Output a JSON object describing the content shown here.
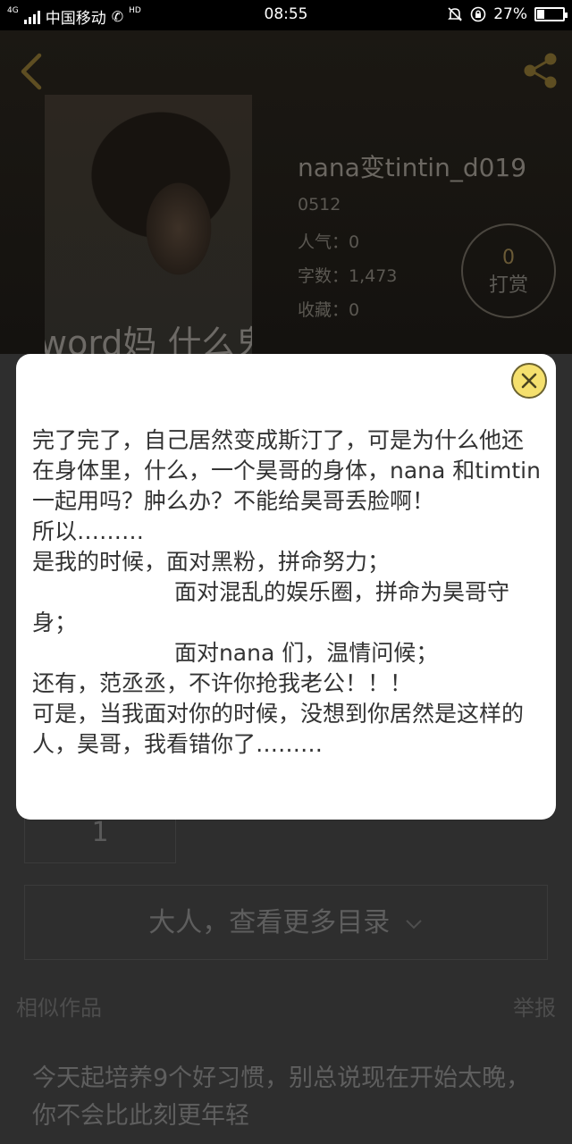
{
  "status_bar": {
    "network_badge": "4G",
    "carrier": "中国移动",
    "hd_badge": "HD",
    "time": "08:55",
    "battery_percent_text": "27%",
    "battery_level": 0.27
  },
  "book": {
    "cover_caption": "word妈 什么鬼",
    "title": "nana变tintin_d019",
    "id_text": "0512",
    "popularity": "人气：0",
    "word_count": "字数：1,473",
    "favorites": "收藏：0",
    "reward_count": "0",
    "reward_label": "打赏"
  },
  "page": {
    "chapter_value": "1",
    "more_catalog": "大人，查看更多目录",
    "similar_label": "相似作品",
    "report_label": "举报",
    "similar_item_text": "今天起培养9个好习惯，别总说现在开始太晚，你不会比此刻更年轻"
  },
  "dialog": {
    "text": "完了完了，自己居然变成斯汀了，可是为什么他还在身体里，什么，一个昊哥的身体，nana 和timtin 一起用吗？肿么办？不能给昊哥丢脸啊！\n所以………\n是我的时候，面对黑粉，拼命努力；\n                    面对混乱的娱乐圈，拼命为昊哥守身；\n                    面对nana 们，温情问候；\n还有，范丞丞，不许你抢我老公！！！\n可是，当我面对你的时候，没想到你居然是这样的人，昊哥，我看错你了………"
  },
  "colors": {
    "accent_gold": "#c8a040",
    "close_button_yellow": "#f5e06e"
  }
}
